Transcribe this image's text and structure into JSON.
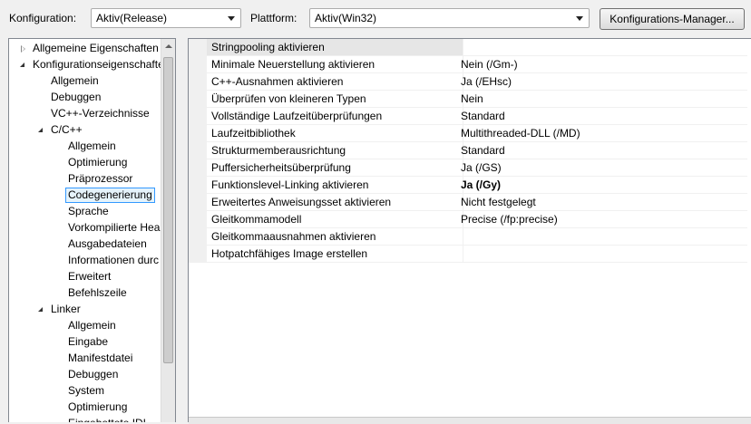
{
  "topbar": {
    "config_label": "Konfiguration:",
    "config_value": "Aktiv(Release)",
    "platform_label": "Plattform:",
    "platform_value": "Aktiv(Win32)",
    "manager_button": "Konfigurations-Manager..."
  },
  "tree": {
    "items": [
      {
        "label": "Allgemeine Eigenschaften",
        "level": 0,
        "expander": "collapsed"
      },
      {
        "label": "Konfigurationseigenschaften",
        "level": 0,
        "expander": "expanded"
      },
      {
        "label": "Allgemein",
        "level": 1
      },
      {
        "label": "Debuggen",
        "level": 1
      },
      {
        "label": "VC++-Verzeichnisse",
        "level": 1
      },
      {
        "label": "C/C++",
        "level": 1,
        "expander": "expanded"
      },
      {
        "label": "Allgemein",
        "level": 2
      },
      {
        "label": "Optimierung",
        "level": 2
      },
      {
        "label": "Präprozessor",
        "level": 2
      },
      {
        "label": "Codegenerierung",
        "level": 2,
        "selected": true
      },
      {
        "label": "Sprache",
        "level": 2
      },
      {
        "label": "Vorkompilierte Hea",
        "level": 2
      },
      {
        "label": "Ausgabedateien",
        "level": 2
      },
      {
        "label": "Informationen durc",
        "level": 2
      },
      {
        "label": "Erweitert",
        "level": 2
      },
      {
        "label": "Befehlszeile",
        "level": 2
      },
      {
        "label": "Linker",
        "level": 1,
        "expander": "expanded"
      },
      {
        "label": "Allgemein",
        "level": 2
      },
      {
        "label": "Eingabe",
        "level": 2
      },
      {
        "label": "Manifestdatei",
        "level": 2
      },
      {
        "label": "Debuggen",
        "level": 2
      },
      {
        "label": "System",
        "level": 2
      },
      {
        "label": "Optimierung",
        "level": 2
      },
      {
        "label": "Eingebettete IDL",
        "level": 2
      }
    ]
  },
  "properties": {
    "rows": [
      {
        "name": "Stringpooling aktivieren",
        "value": "",
        "highlight": true
      },
      {
        "name": "Minimale Neuerstellung aktivieren",
        "value": "Nein (/Gm-)"
      },
      {
        "name": "C++-Ausnahmen aktivieren",
        "value": "Ja (/EHsc)"
      },
      {
        "name": "Überprüfen von kleineren Typen",
        "value": "Nein"
      },
      {
        "name": "Vollständige Laufzeitüberprüfungen",
        "value": "Standard"
      },
      {
        "name": "Laufzeitbibliothek",
        "value": "Multithreaded-DLL (/MD)"
      },
      {
        "name": "Strukturmemberausrichtung",
        "value": "Standard"
      },
      {
        "name": "Puffersicherheitsüberprüfung",
        "value": "Ja (/GS)"
      },
      {
        "name": "Funktionslevel-Linking aktivieren",
        "value": "Ja (/Gy)",
        "bold": true
      },
      {
        "name": "Erweitertes Anweisungsset aktivieren",
        "value": "Nicht festgelegt"
      },
      {
        "name": "Gleitkommamodell",
        "value": "Precise (/fp:precise)"
      },
      {
        "name": "Gleitkommaausnahmen aktivieren",
        "value": ""
      },
      {
        "name": "Hotpatchfähiges Image erstellen",
        "value": ""
      }
    ]
  }
}
